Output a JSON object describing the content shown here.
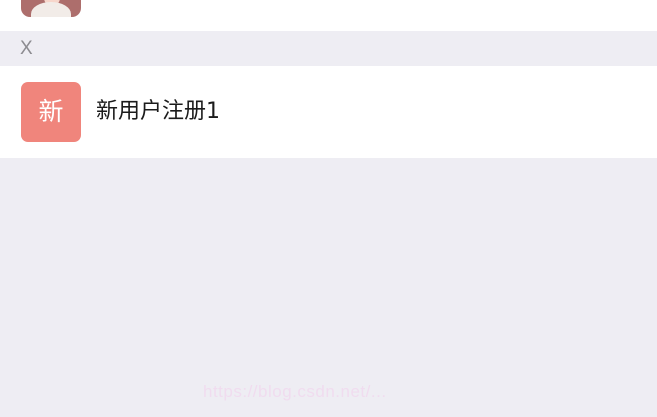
{
  "contacts": {
    "previous_row": {
      "avatar_icon": "person-avatar-icon",
      "avatar_color": "#ad6e6c"
    },
    "sections": [
      {
        "letter": "X",
        "items": [
          {
            "avatar_text": "新",
            "avatar_color": "#f0857c",
            "name": "新用户注册1"
          }
        ]
      }
    ]
  },
  "watermark": {
    "text": "https://blog.csdn.net/..."
  }
}
